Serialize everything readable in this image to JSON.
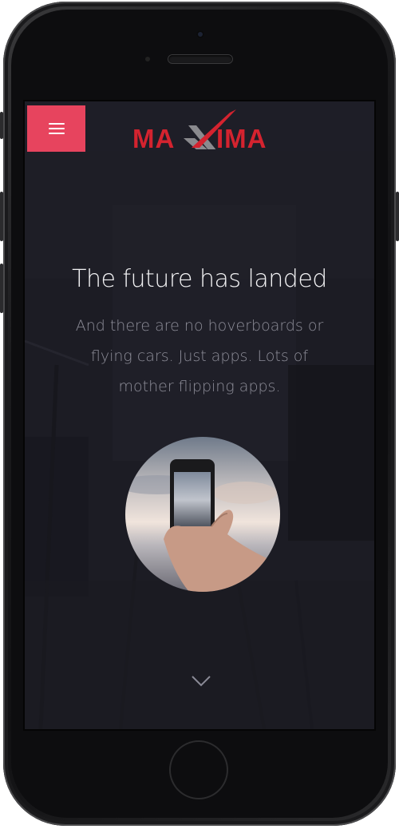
{
  "device": {
    "model": "phone",
    "home_button_icon": "home-button-circle"
  },
  "header": {
    "menu_icon": "hamburger-menu-icon",
    "menu_button_color": "#e7445e",
    "logo": {
      "text_left": "MA",
      "text_mid": "X",
      "text_right": "IMA",
      "color": "#d4232f",
      "accent_color": "#8a8a8e"
    }
  },
  "hero": {
    "title": "The future has landed",
    "subtitle": "And there are no hoverboards or flying cars. Just apps. Lots of mother flipping apps.",
    "image_icon": "hand-holding-phone-photo",
    "scroll_icon": "chevron-down-icon"
  },
  "colors": {
    "screen_background": "#1b1b22",
    "title_color": "#f2f2f4",
    "subtitle_color": "#8d8d98"
  }
}
